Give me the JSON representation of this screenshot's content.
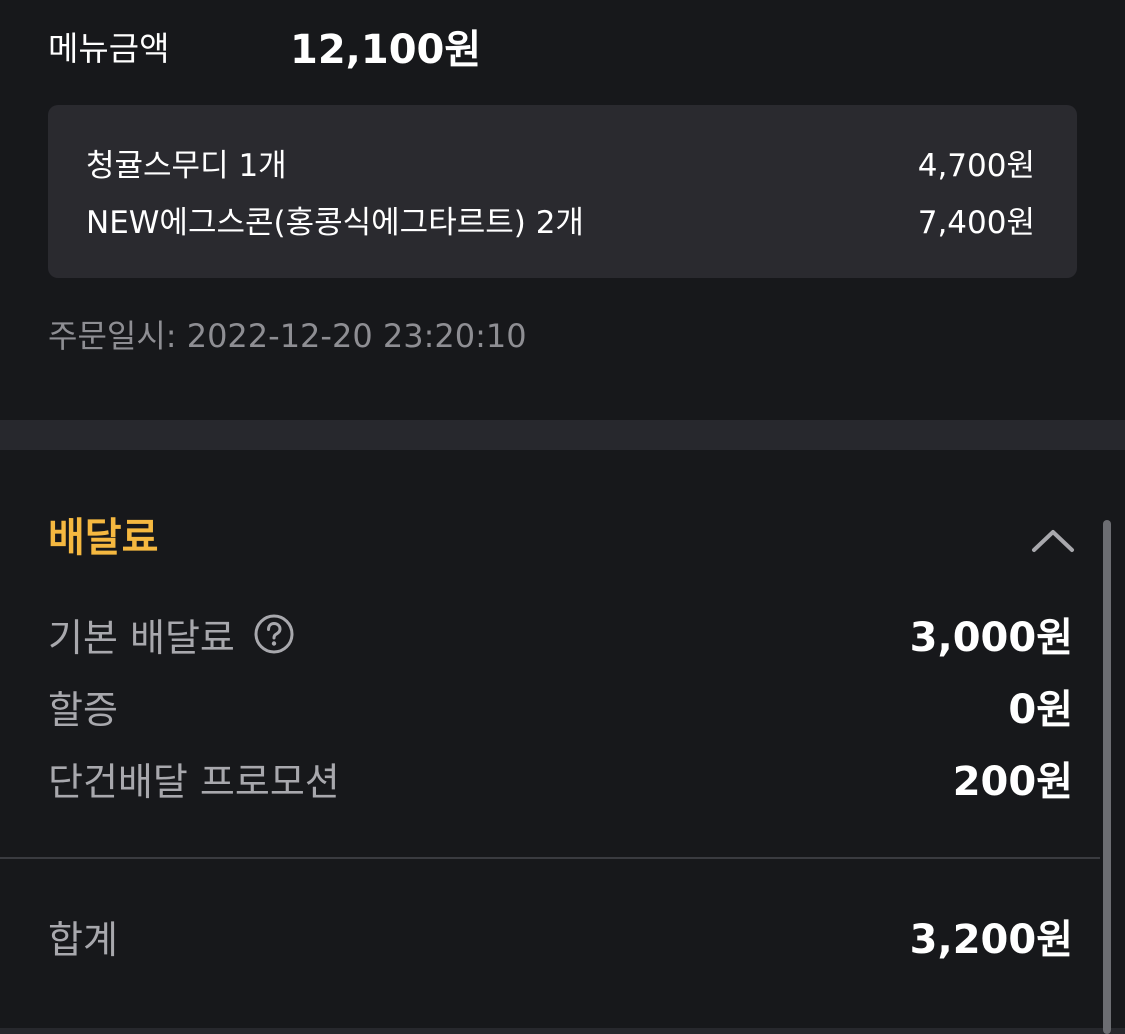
{
  "menu": {
    "label": "메뉴금액",
    "total": "12,100원"
  },
  "items": [
    {
      "name": "청귤스무디 1개",
      "price": "4,700원"
    },
    {
      "name": "NEW에그스콘(홍콩식에그타르트) 2개",
      "price": "7,400원"
    }
  ],
  "order_date": "주문일시: 2022-12-20 23:20:10",
  "delivery_fee": {
    "title": "배달료",
    "rows": [
      {
        "label": "기본 배달료",
        "value": "3,000원",
        "has_help": true
      },
      {
        "label": "할증",
        "value": "0원"
      },
      {
        "label": "단건배달 프로모션",
        "value": "200원"
      }
    ],
    "total_label": "합계",
    "total_value": "3,200원"
  },
  "colors": {
    "background": "#17181b",
    "card": "#2a2a2f",
    "accent": "#f5b840",
    "muted_text": "#a8a8ad"
  },
  "icons": {
    "collapse": "chevron-up-icon",
    "help": "question-circle-icon"
  }
}
